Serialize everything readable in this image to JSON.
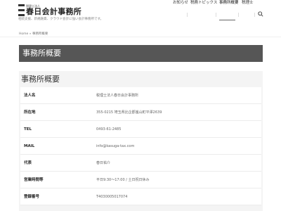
{
  "site": {
    "logo_sub": "税理士法人",
    "logo_main": "春日会計事務所",
    "tagline": "相続支援、新規融資、クラウド会計に強い会計事務所です。"
  },
  "nav": {
    "items": [
      {
        "label": "お知らせ",
        "active": false
      },
      {
        "label": "税務トピックス",
        "active": false
      },
      {
        "label": "事務所概要",
        "active": true
      },
      {
        "label": "税理士",
        "active": false
      }
    ],
    "search_icon": "search-icon"
  },
  "breadcrumb": {
    "home": "Home",
    "separator": " » ",
    "current": "事務所概要"
  },
  "page": {
    "title": "事務所概要",
    "section_title": "事務所概要"
  },
  "profile": [
    {
      "label": "法人名",
      "value": "税理士法人春日会計事務所"
    },
    {
      "label": "所在地",
      "value": "355-0215 埼玉県比企郡嵐山町平澤2639"
    },
    {
      "label": "TEL",
      "value": "0493-61-2485"
    },
    {
      "label": "MAIL",
      "value": "info@kasuga-tax.com"
    },
    {
      "label": "代表",
      "value": "春日祐介"
    },
    {
      "label": "営業時間等",
      "value": "平日9:30～17:00 / 土日祝日休み"
    },
    {
      "label": "登録番号",
      "value": "T4030005017074"
    }
  ],
  "colors": {
    "title_band": "#565656",
    "section_bg": "#f4f4f4"
  }
}
